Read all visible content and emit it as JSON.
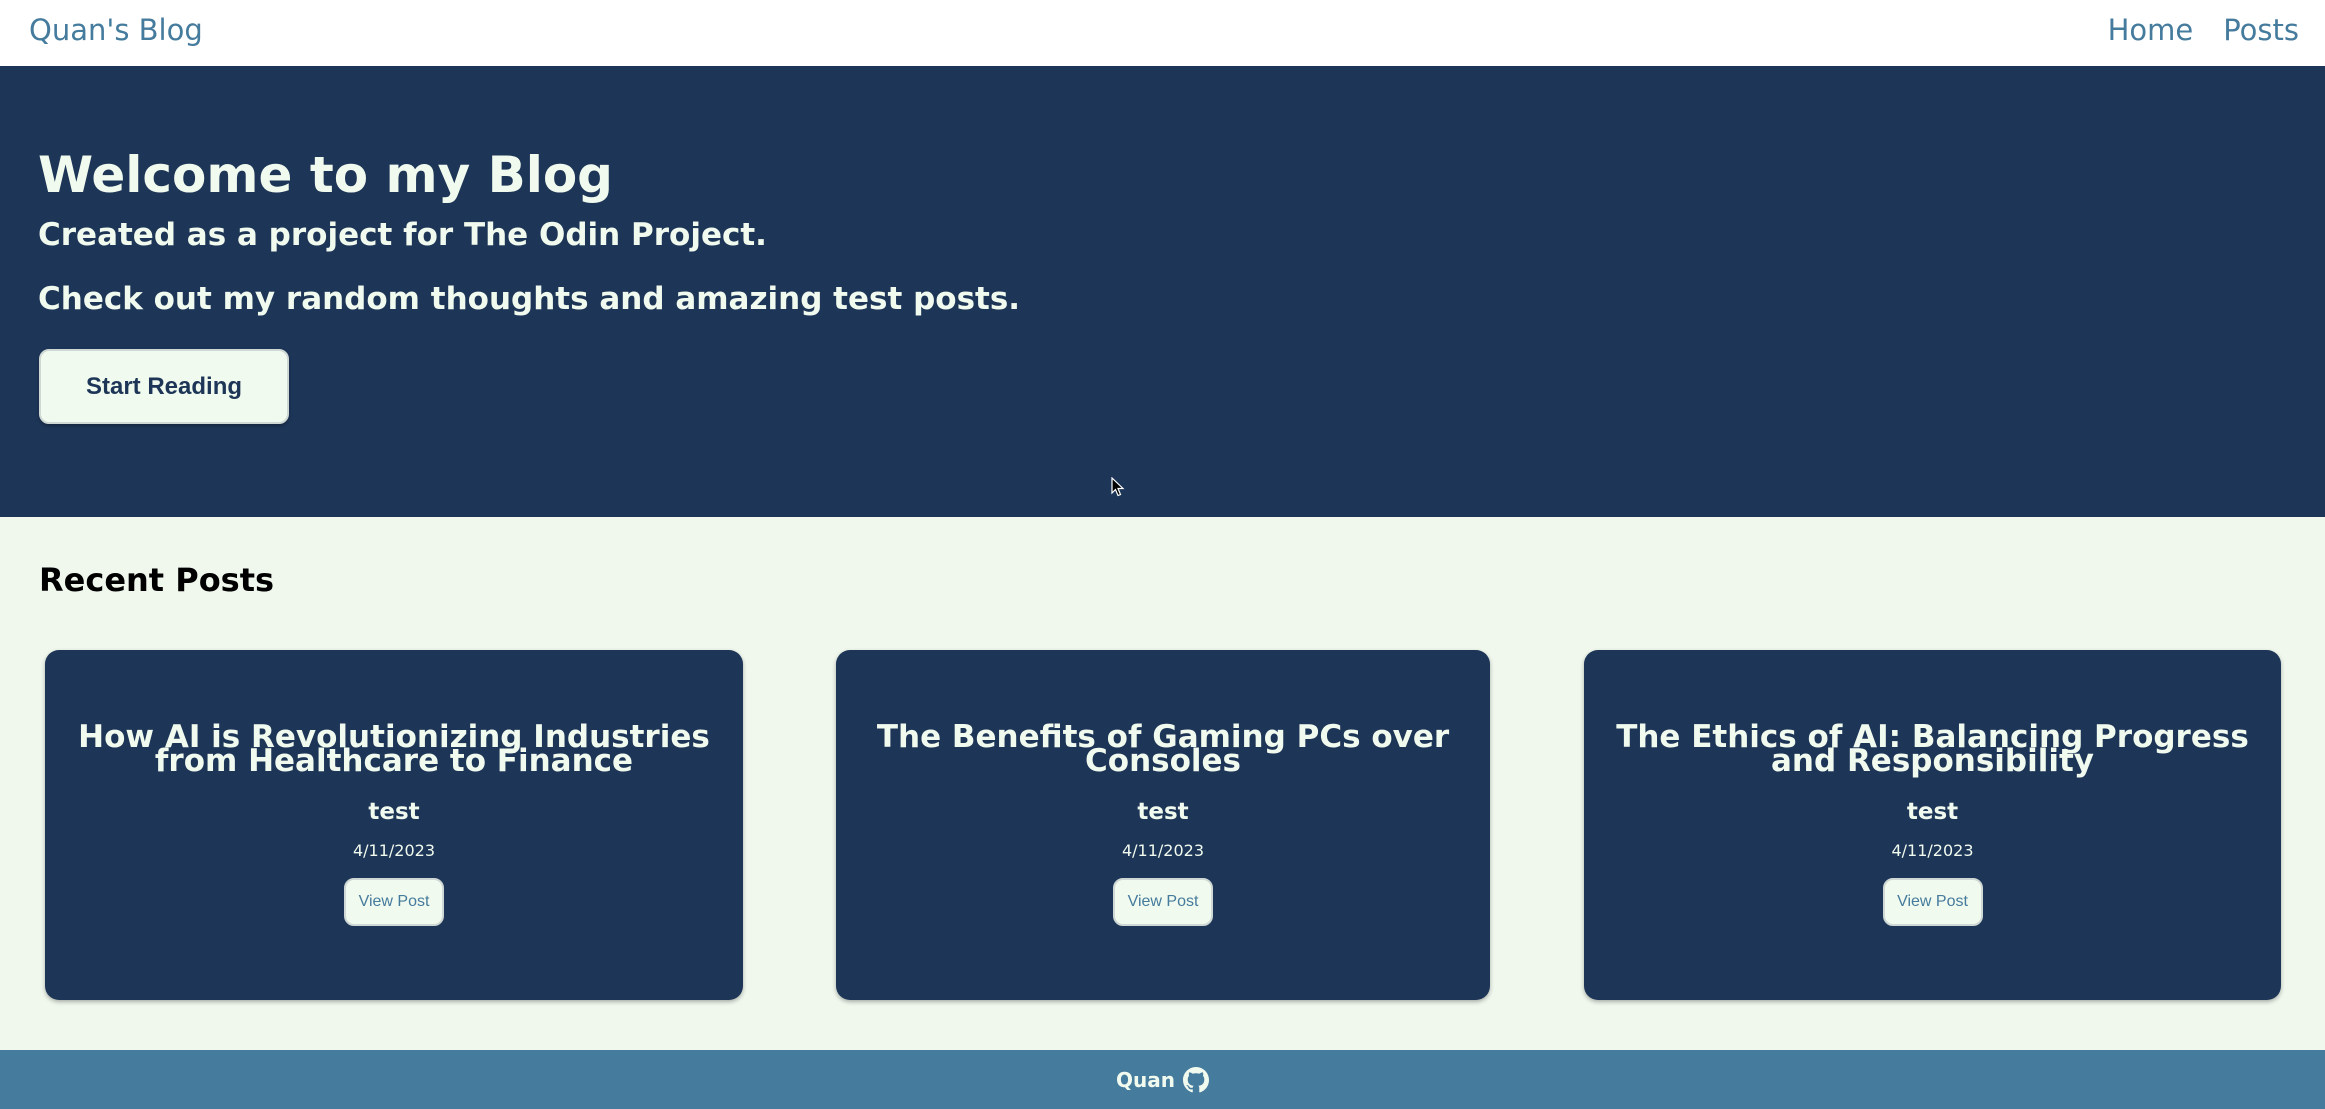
{
  "nav": {
    "brand": "Quan's Blog",
    "links": [
      {
        "label": "Home"
      },
      {
        "label": "Posts"
      }
    ]
  },
  "hero": {
    "title": "Welcome to my Blog",
    "subtitle_1": "Created as a project for The Odin Project.",
    "subtitle_2": "Check out my random thoughts and amazing test posts.",
    "cta_label": "Start Reading"
  },
  "recent": {
    "heading": "Recent Posts",
    "posts": [
      {
        "title": "How AI is Revolutionizing Industries from Healthcare to Finance",
        "author": "test",
        "date": "4/11/2023",
        "button_label": "View Post"
      },
      {
        "title": "The Benefits of Gaming PCs over Consoles",
        "author": "test",
        "date": "4/11/2023",
        "button_label": "View Post"
      },
      {
        "title": "The Ethics of AI: Balancing Progress and Responsibility",
        "author": "test",
        "date": "4/11/2023",
        "button_label": "View Post"
      }
    ]
  },
  "footer": {
    "name": "Quan",
    "icon": "github-icon"
  },
  "colors": {
    "navy": "#1d3557",
    "steel_blue": "#457b9d",
    "mint": "#f1faee",
    "page_bg": "#f0f8ee"
  }
}
